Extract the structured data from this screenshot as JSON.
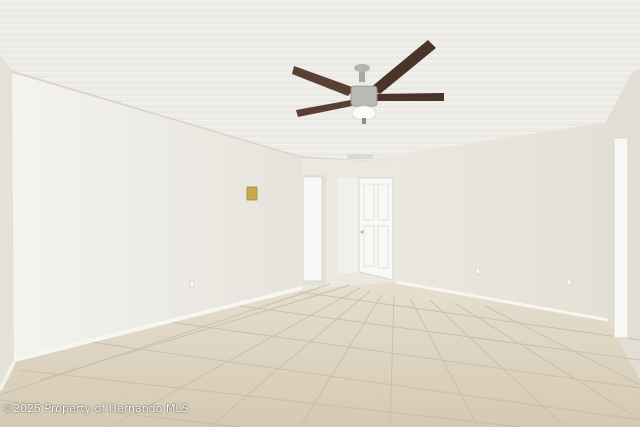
{
  "photo": {
    "room_description": "",
    "watermark_text": "©2025 Property of Hernando MLS"
  },
  "icons": {
    "ceiling_fan": "ceiling-fan-icon",
    "thermostat": "thermostat-icon",
    "outlet": "electrical-outlet-icon"
  },
  "colors": {
    "ceiling": "#f1f0ec",
    "wall_left": "#efede7",
    "wall_back": "#ebe8df",
    "wall_right": "#e9e5db",
    "floor": "#ddd3bf",
    "grout": "#c9bfaa",
    "baseboard": "#f6f5f1",
    "fan_blade": "#4a342a",
    "fan_metal": "#a9a9a9",
    "door": "#f7f7f5",
    "thermostat": "#c8a950"
  }
}
